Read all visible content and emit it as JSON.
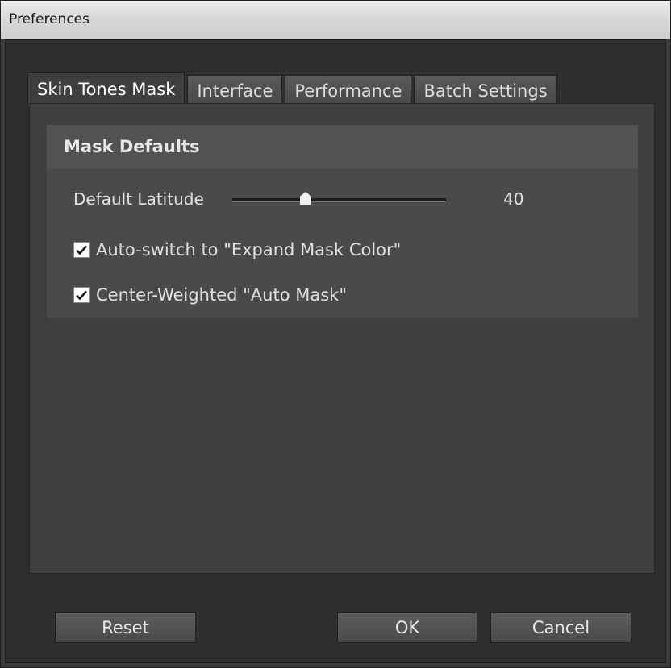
{
  "window": {
    "title": "Preferences"
  },
  "tabs": [
    {
      "label": "Skin Tones Mask",
      "active": true
    },
    {
      "label": "Interface",
      "active": false
    },
    {
      "label": "Performance",
      "active": false
    },
    {
      "label": "Batch Settings",
      "active": false
    }
  ],
  "mask_defaults": {
    "header": "Mask Defaults",
    "latitude": {
      "label": "Default Latitude",
      "value": "40"
    },
    "auto_switch": {
      "label": "Auto-switch to \"Expand Mask Color\"",
      "checked": true
    },
    "center_weighted": {
      "label": "Center-Weighted \"Auto Mask\"",
      "checked": true
    }
  },
  "buttons": {
    "reset": "Reset",
    "ok": "OK",
    "cancel": "Cancel"
  }
}
